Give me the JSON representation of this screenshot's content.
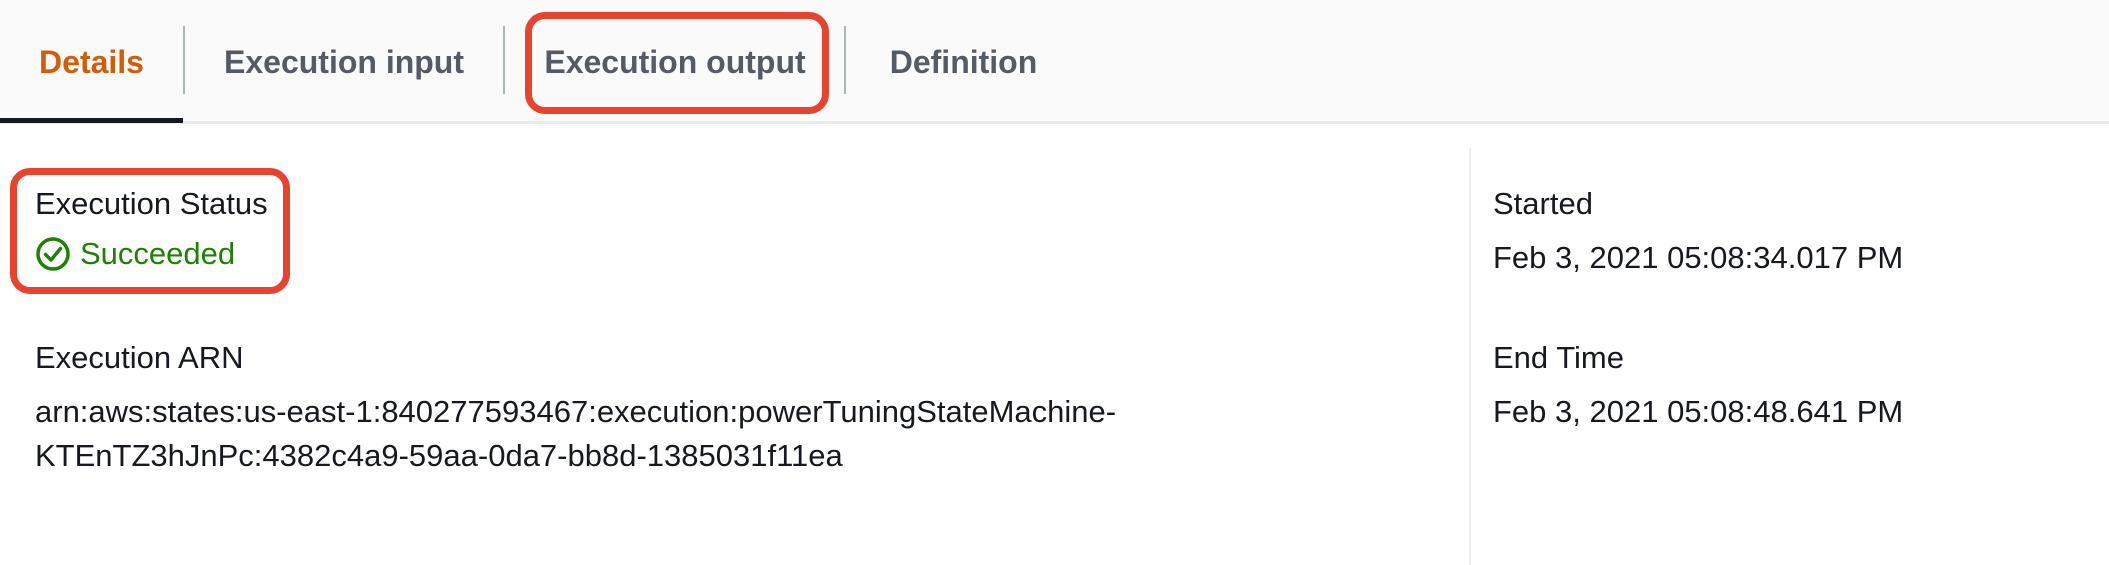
{
  "tabs": [
    {
      "label": "Details",
      "active": true
    },
    {
      "label": "Execution input",
      "active": false
    },
    {
      "label": "Execution output",
      "active": false,
      "highlighted": true
    },
    {
      "label": "Definition",
      "active": false
    }
  ],
  "details": {
    "status_label": "Execution Status",
    "status_value": "Succeeded",
    "status_icon": "check-circle-icon",
    "arn_label": "Execution ARN",
    "arn_line1": "arn:aws:states:us-east-1:840277593467:execution:powerTuningStateMachine-",
    "arn_line2": "KTEnTZ3hJnPc:4382c4a9-59aa-0da7-bb8d-1385031f11ea",
    "started_label": "Started",
    "started_value": "Feb 3, 2021 05:08:34.017 PM",
    "end_label": "End Time",
    "end_value": "Feb 3, 2021 05:08:48.641 PM"
  },
  "colors": {
    "active_tab": "#d45b07",
    "success": "#1d8102",
    "highlight": "#e8432f"
  }
}
